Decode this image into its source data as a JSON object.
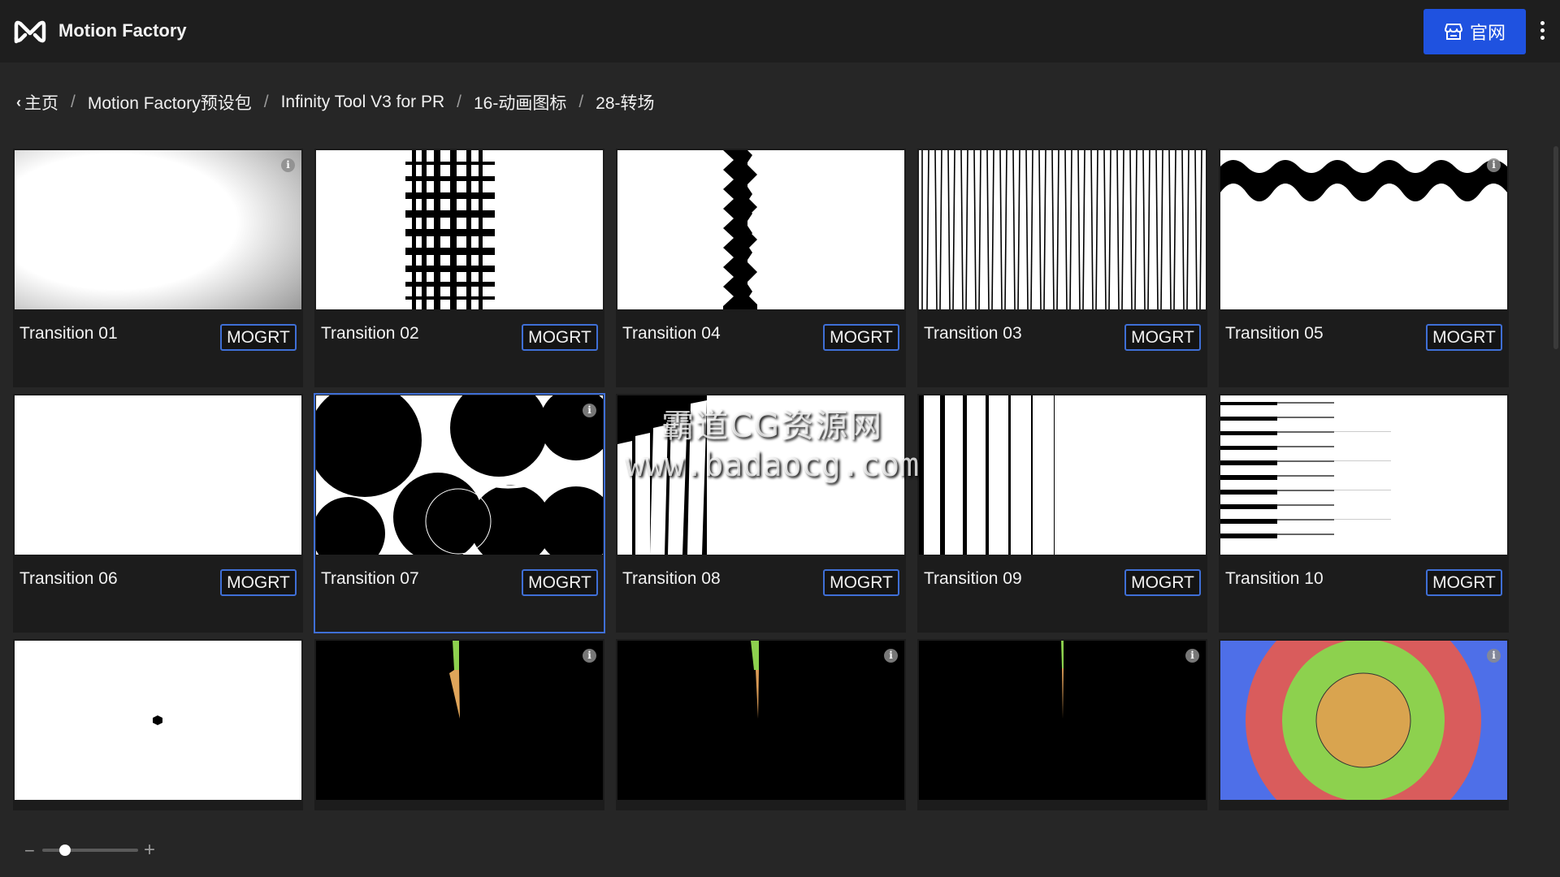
{
  "header": {
    "app_title": "Motion Factory",
    "logo_icon": "infinity-m-logo",
    "site_button_label": "官网",
    "site_button_icon": "store-icon",
    "more_icon": "more-vertical-icon"
  },
  "breadcrumb": {
    "back_icon": "chevron-left-icon",
    "items": [
      "主页",
      "Motion Factory预设包",
      "Infinity Tool V3 for PR",
      "16-动画图标",
      "28-转场"
    ]
  },
  "grid": {
    "badge_label": "MOGRT",
    "info_icon": "info-icon",
    "cards": [
      {
        "title": "Transition 01",
        "thumb": "white-vignette",
        "selected": false
      },
      {
        "title": "Transition 02",
        "thumb": "black-grid-bars",
        "selected": false
      },
      {
        "title": "Transition 04",
        "thumb": "black-zigzag-column",
        "selected": false
      },
      {
        "title": "Transition 03",
        "thumb": "vertical-stripes",
        "selected": false
      },
      {
        "title": "Transition 05",
        "thumb": "black-wave-top",
        "selected": false
      },
      {
        "title": "Transition 06",
        "thumb": "blank-white",
        "selected": false
      },
      {
        "title": "Transition 07",
        "thumb": "black-circles",
        "selected": true
      },
      {
        "title": "Transition 08",
        "thumb": "falling-white-panels",
        "selected": false
      },
      {
        "title": "Transition 09",
        "thumb": "white-vertical-panels",
        "selected": false
      },
      {
        "title": "Transition 10",
        "thumb": "horizontal-lines",
        "selected": false
      },
      {
        "title": "",
        "thumb": "white-dot",
        "selected": false
      },
      {
        "title": "",
        "thumb": "black-spark-1",
        "selected": false
      },
      {
        "title": "",
        "thumb": "black-spark-2",
        "selected": false
      },
      {
        "title": "",
        "thumb": "black-spark-3",
        "selected": false
      },
      {
        "title": "",
        "thumb": "concentric-circles",
        "selected": false
      }
    ]
  },
  "watermark": {
    "line1": "霸道CG资源网",
    "line2": "www.badaocg.com"
  },
  "zoom": {
    "level": 0.2,
    "minus_label": "−",
    "plus_label": "+"
  },
  "colors": {
    "accent": "#1f52e0",
    "outline": "#3f6fd6",
    "background": "#262626"
  }
}
